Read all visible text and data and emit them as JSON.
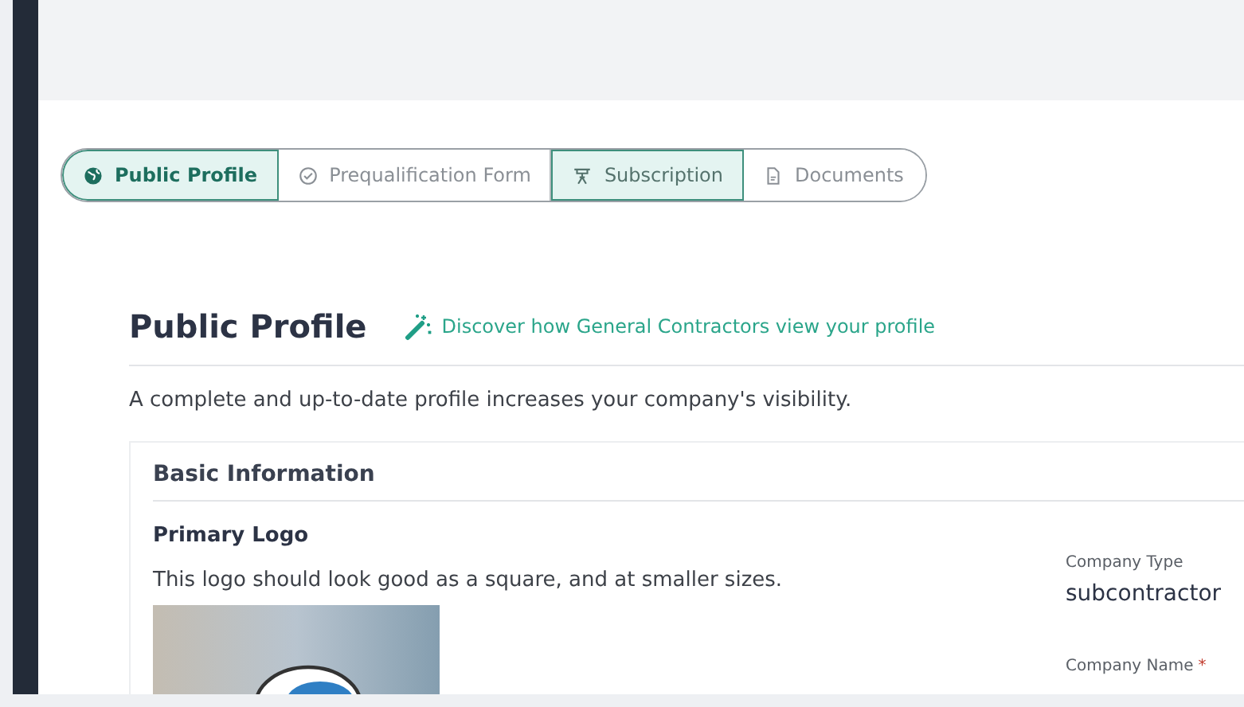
{
  "tabs": [
    {
      "label": "Public Profile",
      "selected": true,
      "hovered": false
    },
    {
      "label": "Prequalification Form",
      "selected": false,
      "hovered": false
    },
    {
      "label": "Subscription",
      "selected": false,
      "hovered": true
    },
    {
      "label": "Documents",
      "selected": false,
      "hovered": false
    }
  ],
  "page": {
    "title": "Public Profile",
    "link": "Discover how General Contractors view your profile",
    "description": "A complete and up-to-date profile increases your company's visibility."
  },
  "card": {
    "title": "Basic Information",
    "logo_title": "Primary Logo",
    "logo_hint": "This logo should look good as a square, and at smaller sizes.",
    "fields": [
      {
        "label": "Company Type",
        "value": "subcontractor"
      },
      {
        "label": "Company Name",
        "required_mark": "*"
      }
    ]
  }
}
